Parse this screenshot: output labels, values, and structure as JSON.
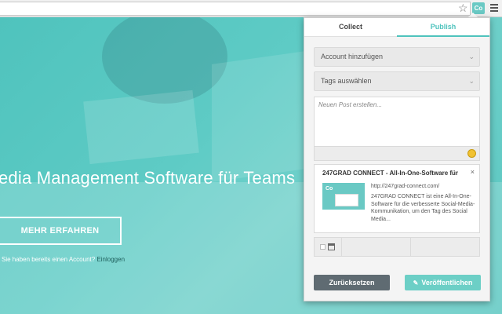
{
  "browser": {
    "star_glyph": "☆",
    "extension_label": "Co"
  },
  "hero": {
    "title": "edia Management Software für Teams",
    "cta_label": "MEHR ERFAHREN",
    "account_text": "Sie haben bereits einen Account?",
    "login_label": "Einloggen"
  },
  "popup": {
    "tabs": [
      {
        "label": "Collect",
        "active": false
      },
      {
        "label": "Publish",
        "active": true
      }
    ],
    "account_select": {
      "label": "Account hinzufügen",
      "icon": "chevron-down-icon"
    },
    "tags_select": {
      "label": "Tags auswählen",
      "icon": "chevron-down-icon"
    },
    "post_placeholder": "Neuen Post erstellen...",
    "link_card": {
      "title": "247GRAD CONNECT - All-In-One-Software für",
      "close_glyph": "×",
      "thumb_logo": "Co",
      "url": "http://247grad-connect.com/",
      "description": "247GRAD CONNECT ist eine All-In-One-Software für die verbesserte Social-Media-Kommunikation, um den Tag des Social Media..."
    },
    "reset_label": "Zurücksetzen",
    "publish_label": "Veröffentlichen",
    "pencil_glyph": "✎"
  },
  "colors": {
    "brand_teal": "#4fc3bd",
    "reset_gray": "#5f6b72",
    "publish_teal": "#6ccfc6"
  }
}
